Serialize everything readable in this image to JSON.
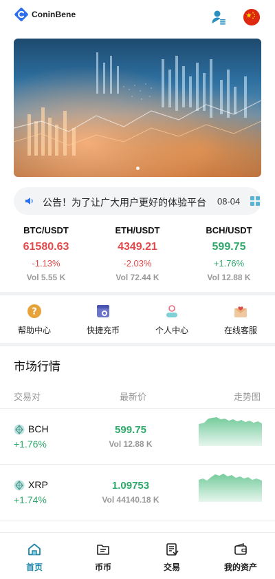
{
  "header": {
    "brand": "ConinBene",
    "user_icon": "user-list-icon",
    "flag_icon": "china-flag-icon"
  },
  "banner": {
    "slide_count": 2
  },
  "notice": {
    "icon": "speaker-icon",
    "text": "公告！为了让广大用户更好的体验平台",
    "date": "08-04",
    "more_icon": "grid-icon"
  },
  "tickers": [
    {
      "pair": "BTC/USDT",
      "price": "61580.63",
      "change": "-1.13%",
      "vol": "Vol 5.55 K",
      "trend": "down"
    },
    {
      "pair": "ETH/USDT",
      "price": "4349.21",
      "change": "-2.03%",
      "vol": "Vol 72.44 K",
      "trend": "down"
    },
    {
      "pair": "BCH/USDT",
      "price": "599.75",
      "change": "+1.76%",
      "vol": "Vol 12.88 K",
      "trend": "up"
    }
  ],
  "quick_menu": [
    {
      "label": "帮助中心",
      "icon": "help-icon"
    },
    {
      "label": "快捷充币",
      "icon": "quick-deposit-icon"
    },
    {
      "label": "个人中心",
      "icon": "profile-icon"
    },
    {
      "label": "在线客服",
      "icon": "support-mail-icon"
    }
  ],
  "market": {
    "title": "市场行情",
    "columns": [
      "交易对",
      "最新价",
      "走势图"
    ],
    "rows": [
      {
        "coin": "BCH",
        "change": "+1.76%",
        "price": "599.75",
        "vol": "Vol 12.88 K",
        "trend": "up"
      },
      {
        "coin": "XRP",
        "change": "+1.74%",
        "price": "1.09753",
        "vol": "Vol 44140.18 K",
        "trend": "up"
      }
    ]
  },
  "tabbar": [
    {
      "label": "首页",
      "icon": "home-icon",
      "active": true
    },
    {
      "label": "币币",
      "icon": "coin-exchange-icon",
      "active": false
    },
    {
      "label": "交易",
      "icon": "trade-icon",
      "active": false
    },
    {
      "label": "我的资产",
      "icon": "wallet-icon",
      "active": false
    }
  ],
  "colors": {
    "up": "#2ea86a",
    "down": "#e04a4a",
    "accent": "#1f86a8",
    "brand": "#2c6ff0"
  }
}
